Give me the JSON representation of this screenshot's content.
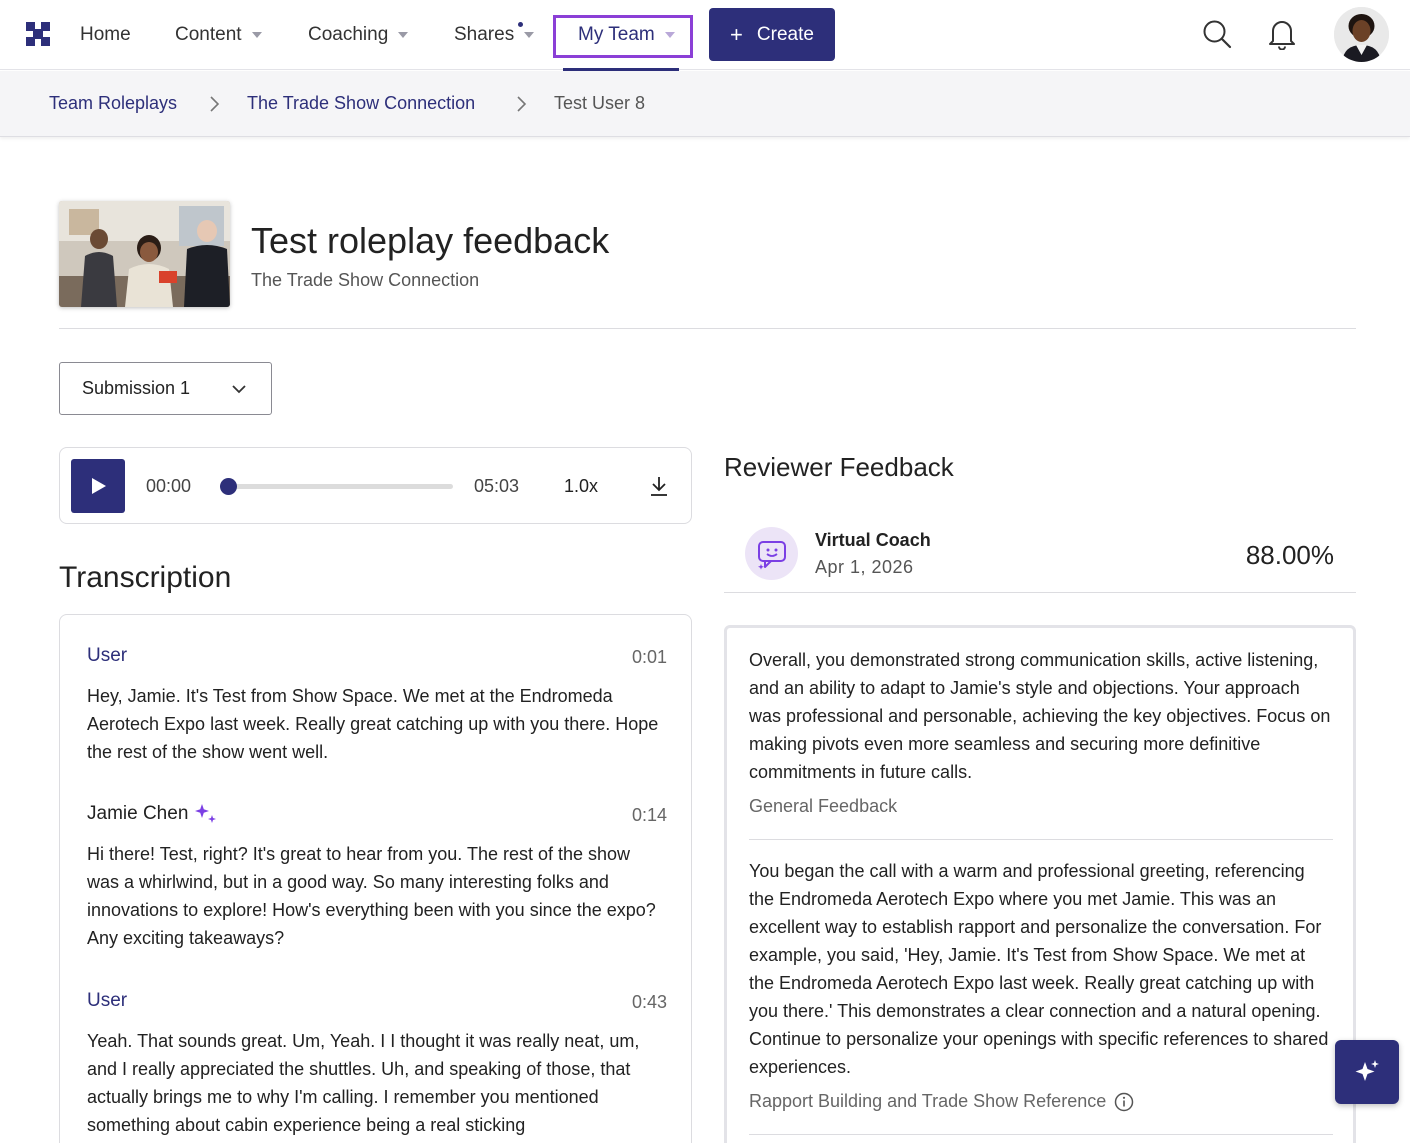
{
  "nav": {
    "items": [
      {
        "label": "Home"
      },
      {
        "label": "Content"
      },
      {
        "label": "Coaching"
      },
      {
        "label": "Shares"
      },
      {
        "label": "My Team"
      }
    ],
    "create_label": "Create"
  },
  "breadcrumb": {
    "items": [
      "Team Roleplays",
      "The Trade Show Connection",
      "Test User 8"
    ]
  },
  "header": {
    "title": "Test roleplay feedback",
    "subtitle": "The Trade Show Connection"
  },
  "submission": {
    "selected": "Submission 1"
  },
  "player": {
    "current_time": "00:00",
    "total_time": "05:03",
    "speed": "1.0x",
    "progress": 0
  },
  "transcription": {
    "title": "Transcription",
    "utterances": [
      {
        "speaker": "User",
        "time": "0:01",
        "text": "Hey, Jamie. It's Test from Show Space. We met at the Endromeda Aerotech Expo last week. Really great catching up with you there. Hope the rest of the show went well."
      },
      {
        "speaker": "Jamie Chen",
        "time": "0:14",
        "text": "Hi there! Test, right? It's great to hear from you. The rest of the show was a whirlwind, but in a good way. So many interesting folks and innovations to explore! How's everything been with you since the expo? Any exciting takeaways?"
      },
      {
        "speaker": "User",
        "time": "0:43",
        "text": "Yeah. That sounds great. Um, Yeah. I I thought it was really neat, um, and I really appreciated the shuttles. Uh, and speaking of those, that actually brings me to why I'm calling. I remember you mentioned something about cabin experience being a real sticking"
      }
    ]
  },
  "reviewer": {
    "title": "Reviewer Feedback",
    "coach_name": "Virtual Coach",
    "date": "Apr 1, 2026",
    "score": "88.00%",
    "feedback": [
      {
        "text": "Overall, you demonstrated strong communication skills, active listening, and an ability to adapt to Jamie's style and objections. Your approach was professional and personable, achieving the key objectives. Focus on making pivots even more seamless and securing more definitive commitments in future calls.",
        "category": "General Feedback"
      },
      {
        "text": "You began the call with a warm and professional greeting, referencing the Endromeda Aerotech Expo where you met Jamie. This was an excellent way to establish rapport and personalize the conversation. For example, you said, 'Hey, Jamie. It's Test from Show Space. We met at the Endromeda Aerotech Expo last week. Really great catching up with you there.' This demonstrates a clear connection and a natural opening. Continue to personalize your openings with specific references to shared experiences.",
        "category": "Rapport Building and Trade Show Reference"
      }
    ]
  },
  "colors": {
    "brand": "#2d2f7a",
    "highlight": "#8b3fd6",
    "accent_purple": "#7b3fe4"
  }
}
